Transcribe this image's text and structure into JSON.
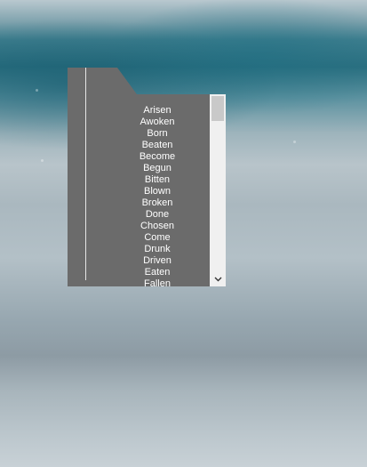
{
  "dropdown": {
    "items": [
      "Arisen",
      "Awoken",
      "Born",
      "Beaten",
      "Become",
      "Begun",
      "Bitten",
      "Blown",
      "Broken",
      "Done",
      "Chosen",
      "Come",
      "Drunk",
      "Driven",
      "Eaten",
      "Fallen"
    ]
  },
  "icons": {
    "scroll_down": "chevron-down-icon"
  }
}
